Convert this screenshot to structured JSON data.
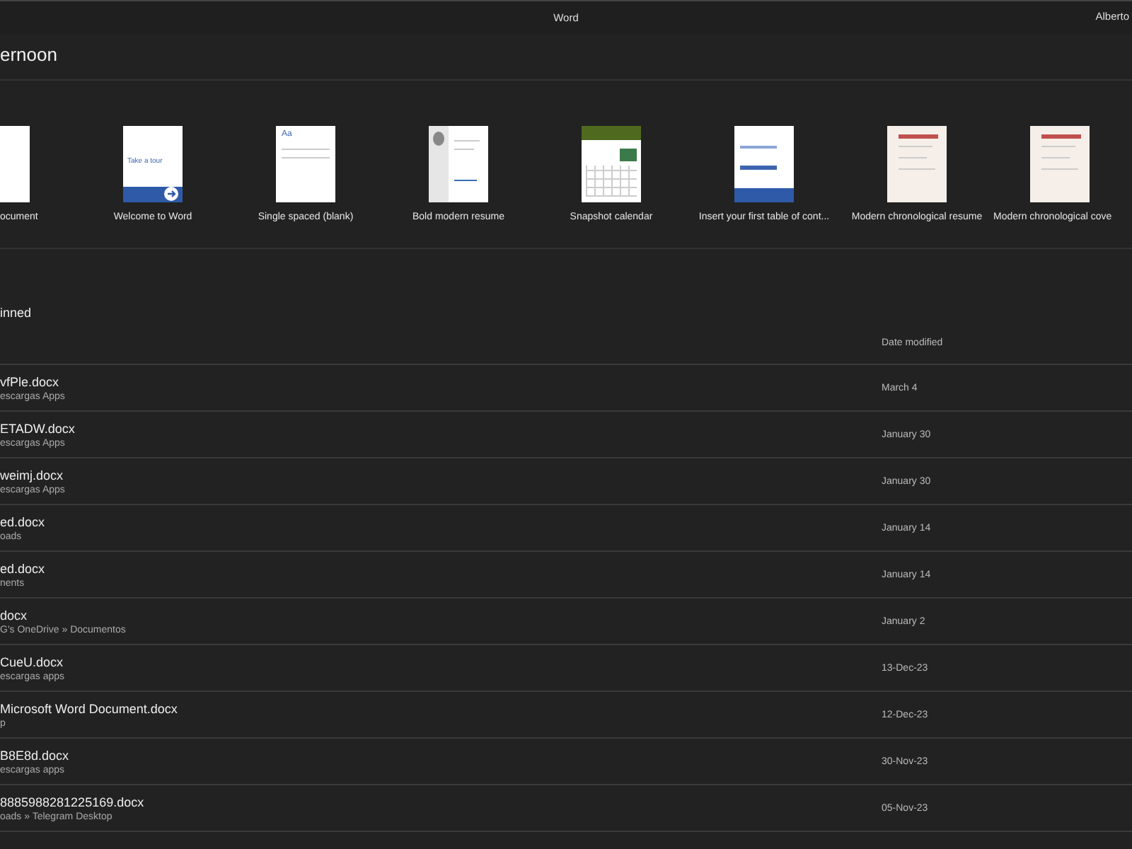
{
  "window": {
    "title": "Word",
    "user": "Alberto"
  },
  "greeting": "ernoon",
  "templates": [
    {
      "label": "ocument",
      "kind": "blank"
    },
    {
      "label": "Welcome to Word",
      "kind": "tour",
      "caption": "Take a tour"
    },
    {
      "label": "Single spaced (blank)",
      "kind": "spaced",
      "caption": "Aa"
    },
    {
      "label": "Bold modern resume",
      "kind": "resume"
    },
    {
      "label": "Snapshot calendar",
      "kind": "calendar"
    },
    {
      "label": "Insert your first table of cont...",
      "kind": "toc"
    },
    {
      "label": "Modern chronological resume",
      "kind": "chrono"
    },
    {
      "label": "Modern chronological cove",
      "kind": "chrono"
    }
  ],
  "section_tab": "inned",
  "table": {
    "columns": [
      "Date modified"
    ],
    "rows": [
      {
        "name": "vfPle.docx",
        "location": "escargas Apps",
        "date": "March 4"
      },
      {
        "name": "ETADW.docx",
        "location": "escargas Apps",
        "date": "January 30"
      },
      {
        "name": "weimj.docx",
        "location": "escargas Apps",
        "date": "January 30"
      },
      {
        "name": "ed.docx",
        "location": "oads",
        "date": "January 14"
      },
      {
        "name": "ed.docx",
        "location": "nents",
        "date": "January 14"
      },
      {
        "name": "docx",
        "location": "G's OneDrive » Documentos",
        "date": "January 2"
      },
      {
        "name": "CueU.docx",
        "location": "escargas apps",
        "date": "13-Dec-23"
      },
      {
        "name": "Microsoft Word Document.docx",
        "location": "p",
        "date": "12-Dec-23"
      },
      {
        "name": "B8E8d.docx",
        "location": "escargas apps",
        "date": "30-Nov-23"
      },
      {
        "name": "8885988281225169.docx",
        "location": "oads » Telegram Desktop",
        "date": "05-Nov-23"
      }
    ]
  }
}
